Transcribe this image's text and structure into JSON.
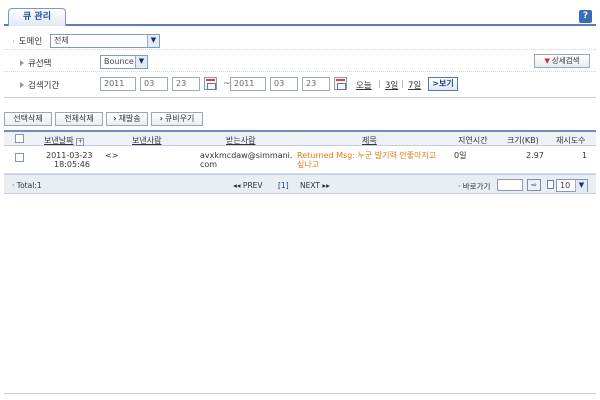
{
  "header": {
    "tab_label": "큐 관리",
    "help_label": "?"
  },
  "search": {
    "domain_label": "도메인",
    "domain_value": "전체",
    "queue_label": "큐선택",
    "queue_value": "Bounce",
    "detail_button": "상세검색",
    "period_label": "검색기간",
    "from": {
      "year": "2011",
      "month": "03",
      "day": "23"
    },
    "to": {
      "year": "2011",
      "month": "03",
      "day": "23"
    },
    "tilde": "~",
    "quick": {
      "today": "오늘",
      "three_days": "3일",
      "seven_days": "7일",
      "sep": "|"
    },
    "view_button": "보기"
  },
  "actions": {
    "delete_selected": "선택삭제",
    "delete_all": "전체삭제",
    "resend": "재발송",
    "empty_queue": "큐비우기"
  },
  "table": {
    "columns": {
      "sent_date": "보낸날짜",
      "sender": "보낸사람",
      "recipient": "받는사람",
      "subject": "제목",
      "delay": "지연시간",
      "size": "크기(KB)",
      "retries": "재시도수"
    },
    "rows": [
      {
        "date": "2011-03-23",
        "time": "18:05:46",
        "sender": "<>",
        "recipient_line1": "avxkmcdaw@simmani.",
        "recipient_line2": "com",
        "subject_line1": "Returned Msg: 누군 발기력 안좋아지고",
        "subject_line2": "싶나고",
        "delay": "0일",
        "size": "2.97",
        "retries": "1"
      }
    ]
  },
  "pager": {
    "total": "Total:1",
    "prev": "PREV",
    "current_page": "[1]",
    "next": "NEXT",
    "goto_label": "바로가기",
    "per_page": "10"
  },
  "colors": {
    "accent": "#5b7fb3",
    "subject": "#e07b12",
    "header_bg": "#eef2f7"
  }
}
